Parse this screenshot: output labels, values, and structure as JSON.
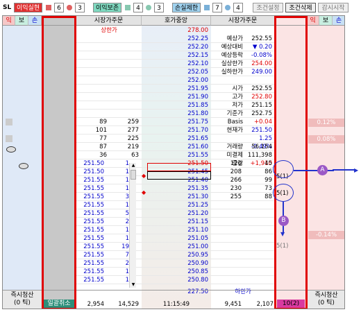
{
  "topbar": {
    "sl": "SL",
    "profit_tag": "이익실현",
    "profit_n1": "6",
    "profit_n2": "3",
    "breakeven_tag": "이익보존",
    "breakeven_n1": "4",
    "breakeven_n2": "3",
    "loss_tag": "손실제한",
    "loss_n1": "7",
    "loss_n2": "4",
    "btn_cond_set": "조건설정",
    "btn_cond_del": "조건삭제",
    "btn_monitor": "감시시작"
  },
  "left_headers": [
    "익",
    "보",
    "손"
  ],
  "right_headers": [
    "익",
    "보",
    "손"
  ],
  "headers": {
    "market_order_left": "시장가주문",
    "center": "호가중앙",
    "market_order_right": "시장가주문"
  },
  "upper_limit_label": "상한가",
  "upper_limit_price": "278.00",
  "lower_limit_label": "하한가",
  "lower_limit_price": "227.50",
  "prices": [
    "252.25",
    "252.20",
    "252.15",
    "252.10",
    "252.05",
    "252.00",
    "251.95",
    "251.90",
    "251.85",
    "251.80",
    "251.75",
    "251.70",
    "251.65",
    "251.60",
    "251.55",
    "251.50",
    "251.45",
    "251.40",
    "251.35",
    "251.30",
    "251.25",
    "251.20",
    "251.15",
    "251.10",
    "251.05",
    "251.00",
    "250.95",
    "250.90",
    "250.85",
    "250.80"
  ],
  "info_panel": [
    {
      "label": "예상가",
      "value": "252.55"
    },
    {
      "label": "예상대비",
      "value": "▼ 0.20"
    },
    {
      "label": "예상등락",
      "value": "-0.08%"
    },
    {
      "label": "실상한가",
      "value": "254.00"
    },
    {
      "label": "실하한가",
      "value": "249.00"
    },
    {
      "label": "",
      "value": ""
    },
    {
      "label": "시가",
      "value": "252.55"
    },
    {
      "label": "고가",
      "value": "252.80"
    },
    {
      "label": "저가",
      "value": "251.15"
    },
    {
      "label": "기준가",
      "value": "252.75"
    },
    {
      "label": "Basis",
      "value": "+0.04"
    },
    {
      "label": "현재가",
      "value": "251.50"
    },
    {
      "label": "",
      "value": "1.25   -0.49%"
    },
    {
      "label": "거래량",
      "value": "56,154"
    },
    {
      "label": "미결제",
      "value": "111,398"
    },
    {
      "label": "증감",
      "value": "+1,910"
    }
  ],
  "ask_rows": [
    {
      "count": "89",
      "qty": "259"
    },
    {
      "count": "101",
      "qty": "277"
    },
    {
      "count": "77",
      "qty": "225"
    },
    {
      "count": "87",
      "qty": "219"
    },
    {
      "count": "36",
      "qty": "63"
    }
  ],
  "bid_rows": [
    {
      "qty": "120",
      "count": "45"
    },
    {
      "qty": "208",
      "count": "86"
    },
    {
      "qty": "266",
      "count": "99"
    },
    {
      "qty": "230",
      "count": "73"
    },
    {
      "qty": "255",
      "count": "88"
    }
  ],
  "my_orders": [
    {
      "price": "251.50",
      "qty": "1"
    },
    {
      "price": "251.50",
      "qty": "1"
    },
    {
      "price": "251.55",
      "qty": "1"
    },
    {
      "price": "251.55",
      "qty": "1"
    },
    {
      "price": "251.55",
      "qty": "3"
    },
    {
      "price": "251.55",
      "qty": "1"
    },
    {
      "price": "251.55",
      "qty": "5"
    },
    {
      "price": "251.55",
      "qty": "2"
    },
    {
      "price": "251.55",
      "qty": "1"
    },
    {
      "price": "251.55",
      "qty": "1"
    },
    {
      "price": "251.55",
      "qty": "19"
    },
    {
      "price": "251.55",
      "qty": "7"
    },
    {
      "price": "251.55",
      "qty": "2"
    },
    {
      "price": "251.55",
      "qty": "1"
    },
    {
      "price": "251.55",
      "qty": "1"
    }
  ],
  "right_orders": [
    "5(1)",
    "5(1)",
    "5(1)"
  ],
  "side_pct": [
    "0.12%",
    "0.08%",
    "-0.14%"
  ],
  "footer": {
    "clear_label": "즉시청산\n(0 틱)",
    "cancel_all": "일괄취소",
    "total_count": "2,954",
    "total_qty": "14,529",
    "time": "11:15:49",
    "bid_total_qty": "9,451",
    "bid_total_count": "2,107",
    "right_total": "10(2)"
  },
  "annotations": {
    "a": "A",
    "b": "B"
  },
  "colors": {
    "red_box": "#e00000",
    "ask_bg": "#dfe9f7",
    "bid_bg": "#fbe4e4",
    "gray_col": "#c8c8c8"
  }
}
